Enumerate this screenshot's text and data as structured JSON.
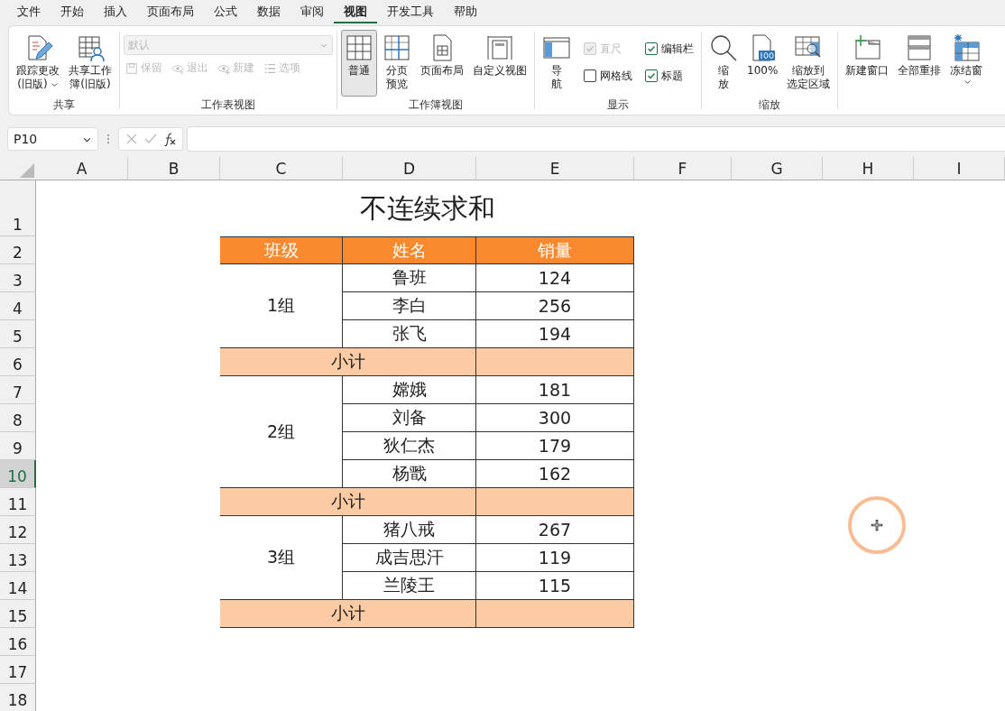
{
  "menu": [
    {
      "label": "文件",
      "selected": false
    },
    {
      "label": "开始",
      "selected": false
    },
    {
      "label": "插入",
      "selected": false
    },
    {
      "label": "页面布局",
      "selected": false
    },
    {
      "label": "公式",
      "selected": false
    },
    {
      "label": "数据",
      "selected": false
    },
    {
      "label": "审阅",
      "selected": false
    },
    {
      "label": "视图",
      "selected": true
    },
    {
      "label": "开发工具",
      "selected": false
    },
    {
      "label": "帮助",
      "selected": false
    }
  ],
  "ribbon": {
    "share": {
      "title": "共享",
      "buttons": [
        {
          "kind": "track",
          "lines": [
            "跟踪更改",
            "(旧版)"
          ],
          "caret": true
        },
        {
          "kind": "share",
          "lines": [
            "共享工作",
            "簿(旧版)"
          ],
          "caret": false
        }
      ]
    },
    "sheet_view": {
      "title": "工作表视图",
      "dropdown": {
        "value": "默认",
        "disabled": true
      },
      "buttons": [
        {
          "kind": "save",
          "label": "保留",
          "disabled": true
        },
        {
          "kind": "exit",
          "label": "退出",
          "disabled": true
        },
        {
          "kind": "new",
          "label": "新建",
          "disabled": true
        },
        {
          "kind": "options",
          "label": "选项",
          "disabled": true
        }
      ]
    },
    "workbook_view": {
      "title": "工作簿视图",
      "buttons": [
        {
          "kind": "normal",
          "lines": [
            "普通"
          ],
          "selected": true
        },
        {
          "kind": "pagebreak",
          "lines": [
            "分页",
            "预览"
          ],
          "selected": false
        },
        {
          "kind": "pagelayout",
          "lines": [
            "页面布局"
          ],
          "selected": false
        },
        {
          "kind": "custom",
          "lines": [
            "自定义视图"
          ],
          "selected": false
        }
      ]
    },
    "show": {
      "title": "显示",
      "nav": {
        "lines": [
          "导",
          "航"
        ]
      },
      "checkboxes": [
        {
          "label": "直尺",
          "checked": true,
          "disabled": true
        },
        {
          "label": "网格线",
          "checked": false,
          "disabled": false
        },
        {
          "label": "编辑栏",
          "checked": true,
          "disabled": false
        },
        {
          "label": "标题",
          "checked": true,
          "disabled": false
        }
      ]
    },
    "zoom": {
      "title": "缩放",
      "buttons": [
        {
          "kind": "zoom",
          "lines": [
            "缩",
            "放"
          ]
        },
        {
          "kind": "zoom100",
          "lines": [
            "100%"
          ]
        },
        {
          "kind": "zoomsel",
          "lines": [
            "缩放到",
            "选定区域"
          ]
        }
      ]
    },
    "window": {
      "buttons": [
        {
          "kind": "newwin",
          "lines": [
            "新建窗口"
          ],
          "caret": false
        },
        {
          "kind": "arrange",
          "lines": [
            "全部重排"
          ],
          "caret": false
        },
        {
          "kind": "freeze",
          "lines": [
            "冻结窗"
          ],
          "caret": true
        }
      ]
    }
  },
  "formula_bar": {
    "name_box": "P10"
  },
  "sheet": {
    "columns": [
      {
        "label": "A",
        "selected": false
      },
      {
        "label": "B",
        "selected": false
      },
      {
        "label": "C",
        "selected": false
      },
      {
        "label": "D",
        "selected": false
      },
      {
        "label": "E",
        "selected": false
      },
      {
        "label": "F",
        "selected": false
      },
      {
        "label": "G",
        "selected": false
      },
      {
        "label": "H",
        "selected": false
      },
      {
        "label": "I",
        "selected": false
      }
    ],
    "rows": [
      {
        "label": "1",
        "selected": false
      },
      {
        "label": "2",
        "selected": false
      },
      {
        "label": "3",
        "selected": false
      },
      {
        "label": "4",
        "selected": false
      },
      {
        "label": "5",
        "selected": false
      },
      {
        "label": "6",
        "selected": false
      },
      {
        "label": "7",
        "selected": false
      },
      {
        "label": "8",
        "selected": false
      },
      {
        "label": "9",
        "selected": false
      },
      {
        "label": "10",
        "selected": true
      },
      {
        "label": "11",
        "selected": false
      },
      {
        "label": "12",
        "selected": false
      },
      {
        "label": "13",
        "selected": false
      },
      {
        "label": "14",
        "selected": false
      },
      {
        "label": "15",
        "selected": false
      },
      {
        "label": "16",
        "selected": false
      },
      {
        "label": "17",
        "selected": false
      },
      {
        "label": "18",
        "selected": false
      }
    ],
    "title": "不连续求和",
    "table": {
      "columns": [
        "班级",
        "姓名",
        "销量"
      ],
      "groups": [
        {
          "name": "1组",
          "members": [
            {
              "name": "鲁班",
              "sales": "124"
            },
            {
              "name": "李白",
              "sales": "256"
            },
            {
              "name": "张飞",
              "sales": "194"
            }
          ],
          "subtotal": "小计"
        },
        {
          "name": "2组",
          "members": [
            {
              "name": "嫦娥",
              "sales": "181"
            },
            {
              "name": "刘备",
              "sales": "300"
            },
            {
              "name": "狄仁杰",
              "sales": "179"
            },
            {
              "name": "杨戬",
              "sales": "162"
            }
          ],
          "subtotal": "小计"
        },
        {
          "name": "3组",
          "members": [
            {
              "name": "猪八戒",
              "sales": "267"
            },
            {
              "name": "成吉思汗",
              "sales": "119"
            },
            {
              "name": "兰陵王",
              "sales": "115"
            }
          ],
          "subtotal": "小计"
        }
      ]
    }
  }
}
